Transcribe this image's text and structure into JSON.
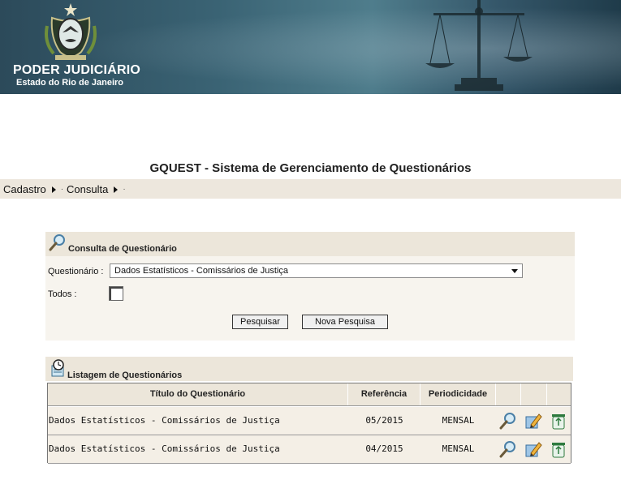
{
  "header": {
    "title": "PODER JUDICIÁRIO",
    "subtitle": "Estado do Rio de Janeiro",
    "icons": [
      "state-crest",
      "justice-scales"
    ]
  },
  "system_title": "GQUEST - Sistema de Gerenciamento de Questionários",
  "menu": {
    "items": [
      {
        "label": "Cadastro"
      },
      {
        "label": "Consulta"
      }
    ]
  },
  "search_panel": {
    "title": "Consulta de Questionário",
    "questionario_label": "Questionário :",
    "questionario_value": "Dados Estatísticos - Comissários de Justiça",
    "todos_label": "Todos :",
    "todos_checked": false,
    "search_button": "Pesquisar",
    "new_search_button": "Nova Pesquisa"
  },
  "list_panel": {
    "title": "Listagem  de Questionários",
    "columns": [
      "Título do Questionário",
      "Referência",
      "Periodicidade"
    ],
    "rows": [
      {
        "titulo": "Dados Estatísticos - Comissários de Justiça",
        "referencia": "05/2015",
        "periodicidade": "MENSAL"
      },
      {
        "titulo": "Dados Estatísticos - Comissários de Justiça",
        "referencia": "04/2015",
        "periodicidade": "MENSAL"
      }
    ],
    "row_actions": [
      "view-icon",
      "edit-icon",
      "delete-icon"
    ]
  },
  "colors": {
    "banner": "#3a6374",
    "menubar": "#ede7dd",
    "panel_header": "#ece6da",
    "row_bg": "#f4efe6"
  }
}
